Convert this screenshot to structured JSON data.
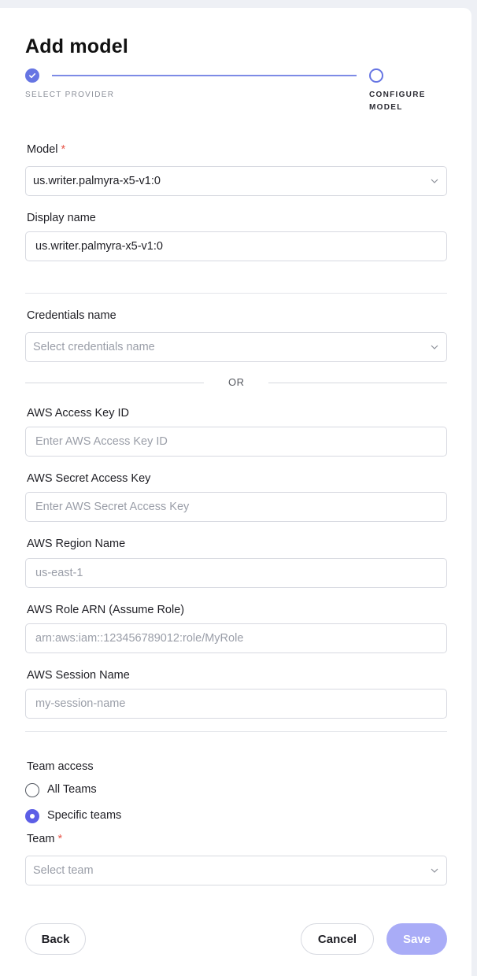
{
  "header": {
    "title": "Add model"
  },
  "stepper": {
    "step1_label": "SELECT PROVIDER",
    "step2_label_line1": "CONFIGURE",
    "step2_label_line2": "MODEL"
  },
  "model": {
    "label": "Model",
    "required": "*",
    "value": "us.writer.palmyra-x5-v1:0"
  },
  "display_name": {
    "label": "Display name",
    "value": "us.writer.palmyra-x5-v1:0"
  },
  "credentials": {
    "label": "Credentials name",
    "placeholder": "Select credentials name"
  },
  "or_text": "OR",
  "aws_access_key": {
    "label": "AWS Access Key ID",
    "placeholder": "Enter AWS Access Key ID"
  },
  "aws_secret_key": {
    "label": "AWS Secret Access Key",
    "placeholder": "Enter AWS Secret Access Key"
  },
  "aws_region": {
    "label": "AWS Region Name",
    "placeholder": "us-east-1"
  },
  "aws_role_arn": {
    "label": "AWS Role ARN (Assume Role)",
    "placeholder": "arn:aws:iam::123456789012:role/MyRole"
  },
  "aws_session": {
    "label": "AWS Session Name",
    "placeholder": "my-session-name"
  },
  "team_access": {
    "label": "Team access",
    "options": [
      {
        "label": "All Teams",
        "selected": false
      },
      {
        "label": "Specific teams",
        "selected": true
      }
    ]
  },
  "team": {
    "label": "Team",
    "required": "*",
    "placeholder": "Select team"
  },
  "footer": {
    "back_label": "Back",
    "cancel_label": "Cancel",
    "save_label": "Save"
  },
  "colors": {
    "accent": "#5c5ee6",
    "stepper": "#6675e3",
    "save_disabled": "#a9acf7",
    "required": "#e7564a"
  },
  "icons": {
    "step_done": "check-icon",
    "select_arrow": "chevron-down-icon"
  }
}
